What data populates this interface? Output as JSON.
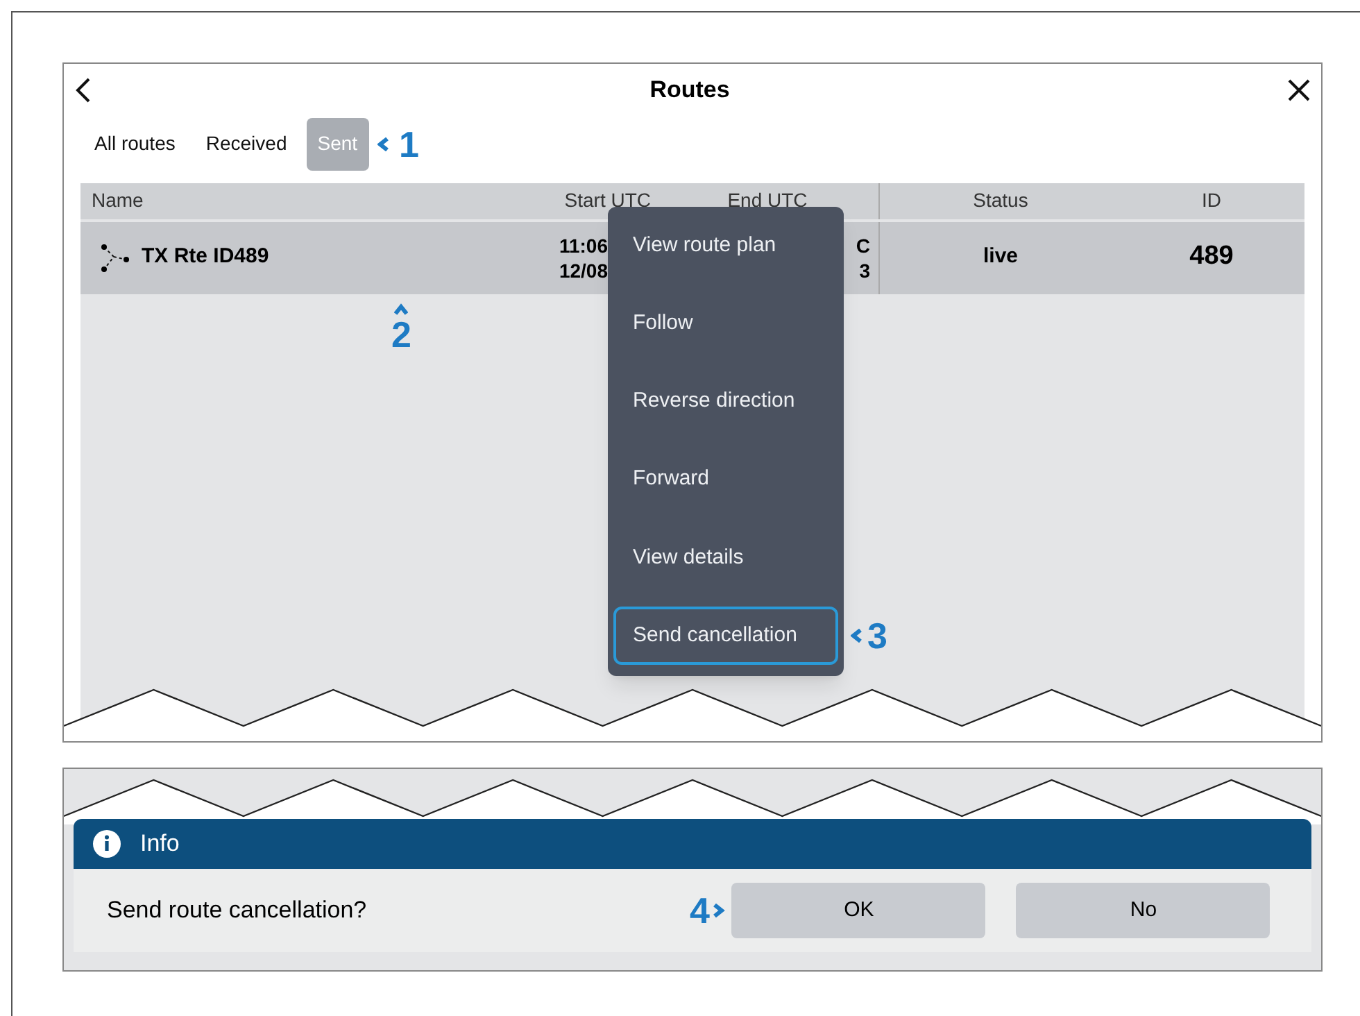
{
  "window": {
    "title": "Routes"
  },
  "tabs": [
    {
      "label": "All routes",
      "selected": false
    },
    {
      "label": "Received",
      "selected": false
    },
    {
      "label": "Sent",
      "selected": true
    }
  ],
  "callouts": [
    "1",
    "2",
    "3",
    "4"
  ],
  "table": {
    "columns": [
      "Name",
      "Start UTC",
      "End UTC",
      "Status",
      "ID"
    ],
    "rows": [
      {
        "name": "TX Rte ID489",
        "start_utc": [
          "11:06",
          "12/08"
        ],
        "end_utc": [
          "C",
          "3"
        ],
        "status": "live",
        "id": "489",
        "selected": true
      }
    ]
  },
  "context_menu": {
    "items": [
      {
        "label": "View route plan",
        "selected": false
      },
      {
        "label": "Follow",
        "selected": false
      },
      {
        "label": "Reverse direction",
        "selected": false
      },
      {
        "label": "Forward",
        "selected": false
      },
      {
        "label": "View details",
        "selected": false
      },
      {
        "label": "Send cancellation",
        "selected": true
      }
    ]
  },
  "dialog": {
    "title": "Info",
    "message": "Send route cancellation?",
    "buttons": [
      "OK",
      "No"
    ]
  }
}
